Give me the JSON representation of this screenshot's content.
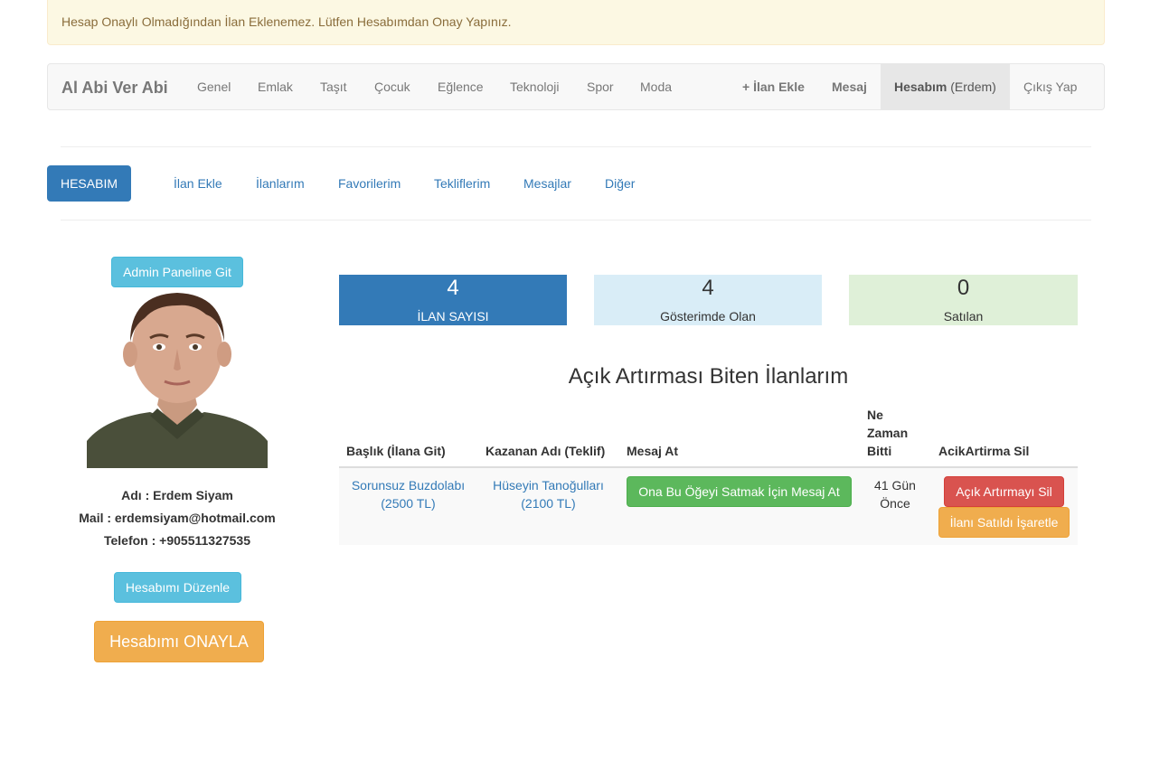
{
  "alert": {
    "text": "Hesap Onaylı Olmadığından İlan Eklenemez. Lütfen Hesabımdan Onay Yapınız."
  },
  "navbar": {
    "brand": "Al Abi Ver Abi",
    "categories": [
      "Genel",
      "Emlak",
      "Taşıt",
      "Çocuk",
      "Eğlence",
      "Teknoloji",
      "Spor",
      "Moda"
    ],
    "add_listing": "+ İlan Ekle",
    "message": "Mesaj",
    "account_bold": "Hesabım",
    "account_user": "(Erdem)",
    "logout": "Çıkış Yap"
  },
  "tabs": {
    "active": "HESABIM",
    "links": [
      "İlan Ekle",
      "İlanlarım",
      "Favorilerim",
      "Tekliflerim",
      "Mesajlar",
      "Diğer"
    ]
  },
  "profile": {
    "admin_button": "Admin Paneline Git",
    "name": "Adı : Erdem Siyam",
    "mail": "Mail : erdemsiyam@hotmail.com",
    "phone": "Telefon : +905511327535",
    "edit_button": "Hesabımı Düzenle",
    "confirm_button": "Hesabımı ONAYLA"
  },
  "stats": [
    {
      "value": "4",
      "label": "İLAN SAYISI",
      "bg": "#337ab7",
      "fg": "#ffffff"
    },
    {
      "value": "4",
      "label": "Gösterimde Olan",
      "bg": "#d9edf7",
      "fg": "#333333"
    },
    {
      "value": "0",
      "label": "Satılan",
      "bg": "#dff0d8",
      "fg": "#333333"
    }
  ],
  "auctions": {
    "title": "Açık Artırması Biten İlanlarım",
    "headers": {
      "title": "Başlık (İlana Git)",
      "winner": "Kazanan Adı (Teklif)",
      "message": "Mesaj At",
      "when_1": "Ne",
      "when_2": "Zaman",
      "when_3": "Bitti",
      "delete": "AcikArtirma Sil"
    },
    "rows": [
      {
        "item_line1": "Sorunsuz Buzdolabı",
        "item_line2": "(2500 TL)",
        "winner_line1": "Hüseyin Tanoğulları",
        "winner_line2": "(2100 TL)",
        "message_button": "Ona Bu Öğeyi Satmak İçin Mesaj At",
        "when_line1": "41 Gün",
        "when_line2": "Önce",
        "delete_button": "Açık Artırmayı Sil",
        "sold_button": "İlanı Satıldı İşaretle"
      }
    ]
  }
}
